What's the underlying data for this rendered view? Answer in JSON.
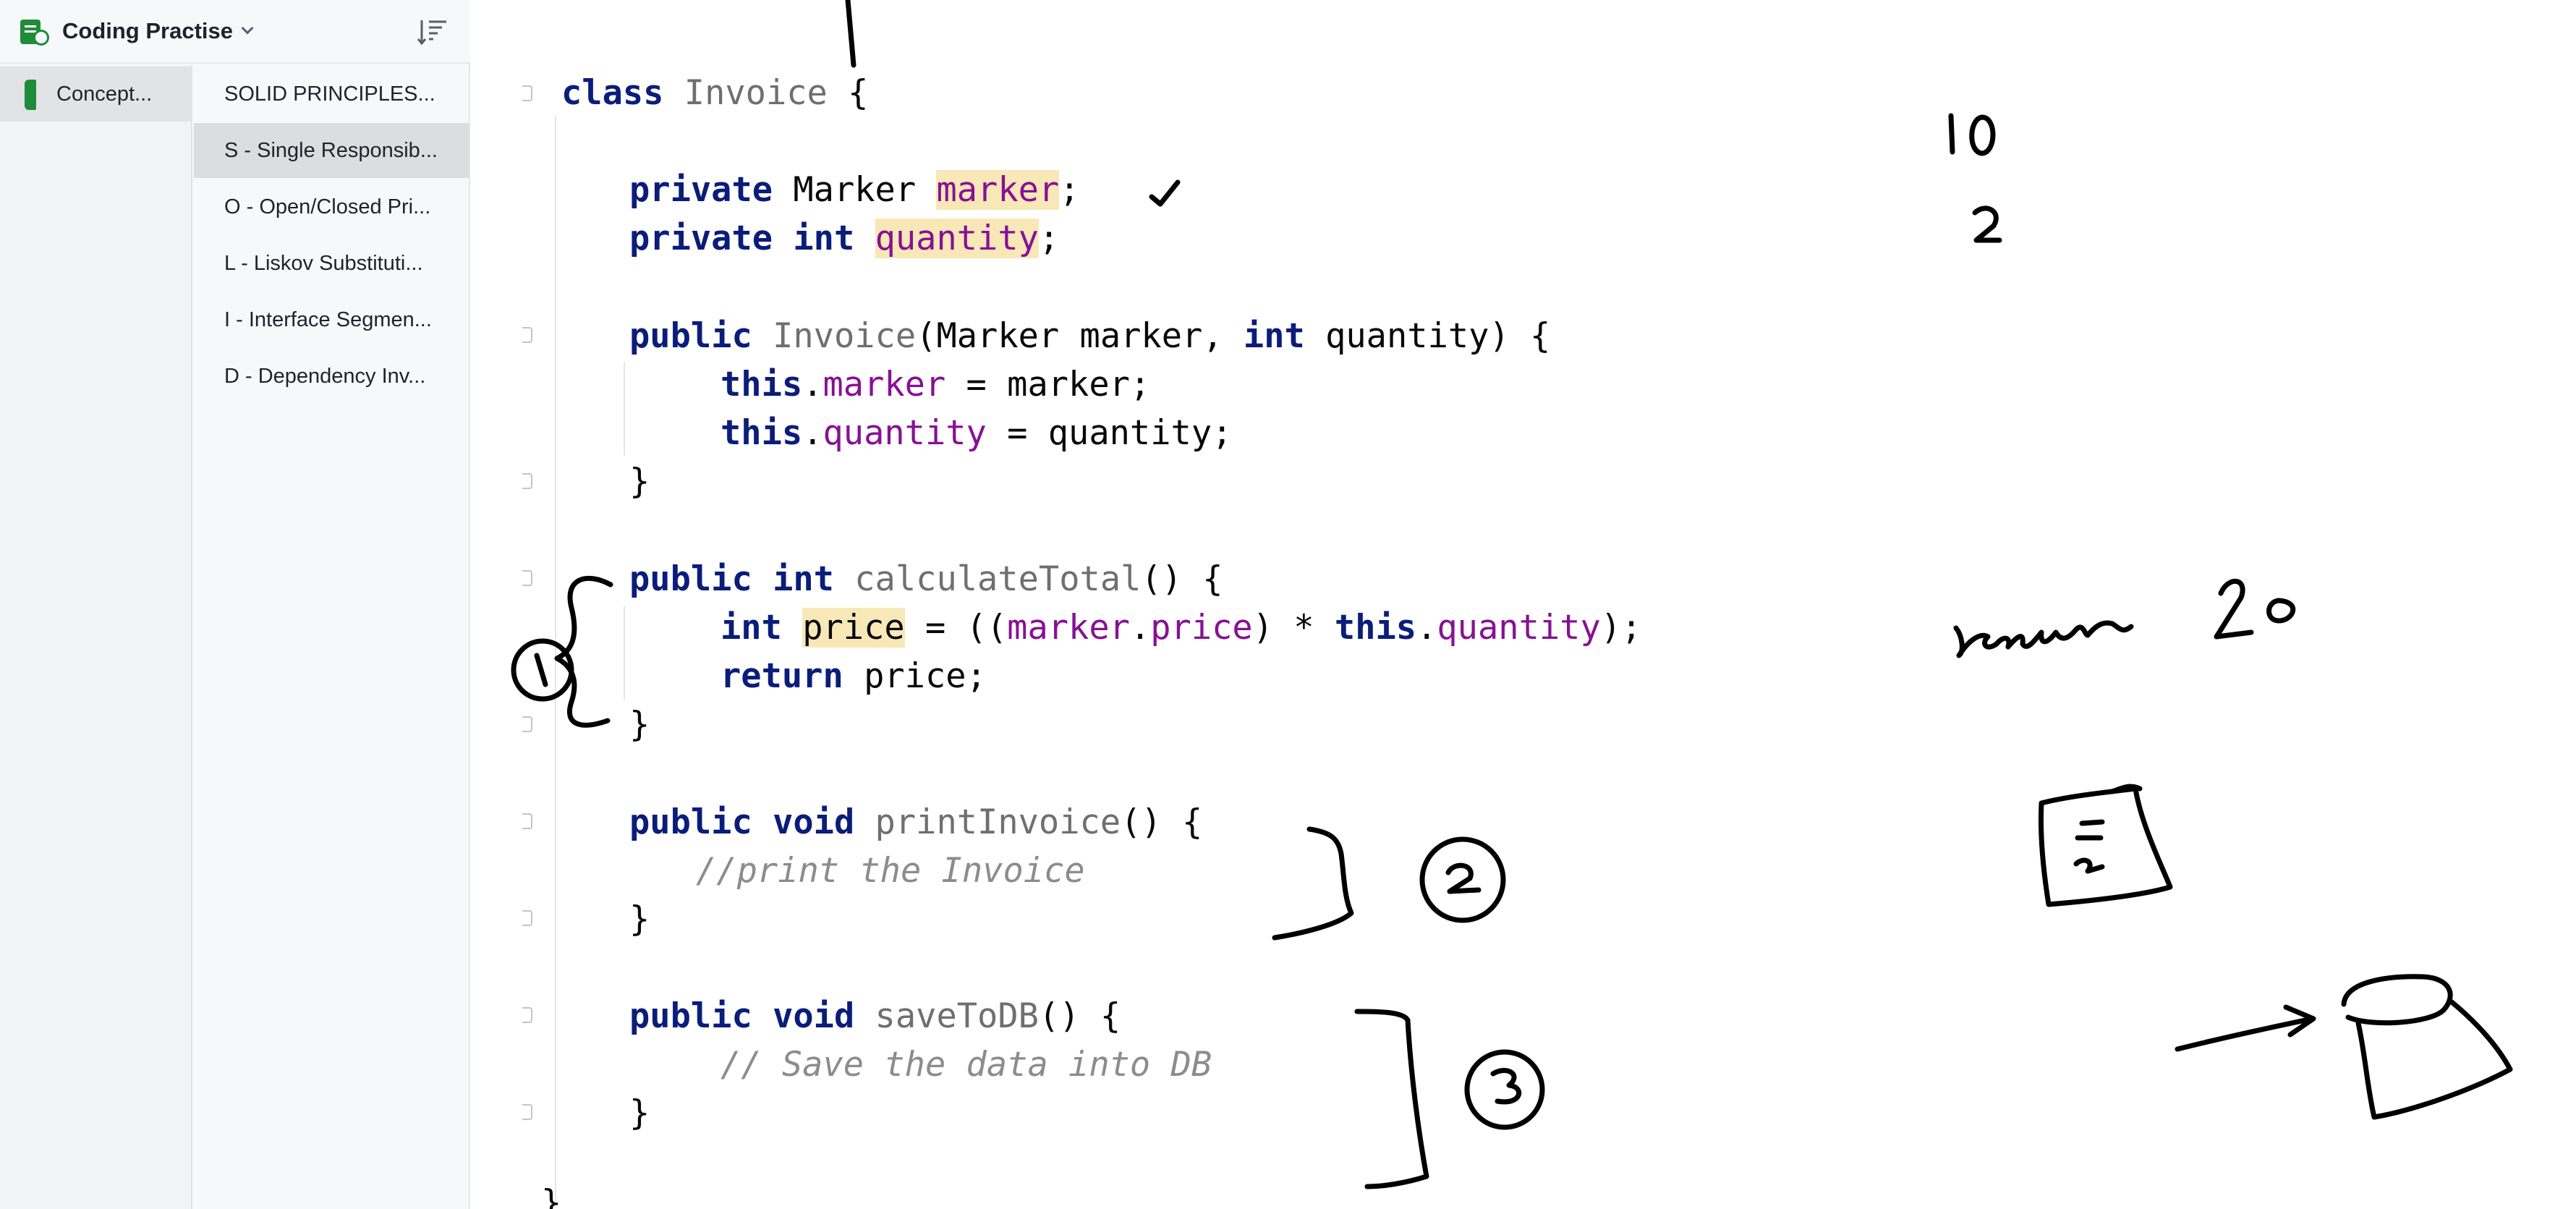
{
  "sidebar": {
    "workspace_title": "Coding Practise",
    "left_items": [
      {
        "label": "Concept..."
      }
    ],
    "right_items": [
      {
        "label": "SOLID PRINCIPLES..."
      },
      {
        "label": "S - Single Responsib..."
      },
      {
        "label": "O - Open/Closed Pri..."
      },
      {
        "label": "L - Liskov Substituti..."
      },
      {
        "label": "I - Interface Segmen..."
      },
      {
        "label": "D - Dependency Inv..."
      }
    ],
    "selected_index": 1,
    "accent_color": "#1e8c3a"
  },
  "editor": {
    "code": {
      "l1_kw": "class",
      "l1_name": "Invoice",
      "l1_rest": " {",
      "l2_kw": "private",
      "l2_type": " Marker ",
      "l2_field": "marker",
      "l2_rest": ";",
      "l3_kw": "private",
      "l3_kw2": " int ",
      "l3_field": "quantity",
      "l3_rest": ";",
      "l4_kw": "public",
      "l4_name": " Invoice",
      "l4_a": "(Marker marker, ",
      "l4_kw2": "int",
      "l4_b": " quantity) {",
      "l5_kw": "this",
      "l5_dot": ".",
      "l5_field": "marker",
      "l5_rest": " = marker;",
      "l6_kw": "this",
      "l6_dot": ".",
      "l6_field": "quantity",
      "l6_rest": " = quantity;",
      "l7": "}",
      "l8_kw": "public int",
      "l8_name": " calculateTotal",
      "l8_rest": "() {",
      "l9_kw": "int",
      "l9_sp": " ",
      "l9_var": "price",
      "l9_a": " = ((",
      "l9_f1": "marker",
      "l9_dot": ".",
      "l9_f2": "price",
      "l9_b": ") * ",
      "l9_kw2": "this",
      "l9_dot2": ".",
      "l9_f3": "quantity",
      "l9_c": ");",
      "l10_kw": "return",
      "l10_rest": " price;",
      "l11": "}",
      "l12_kw": "public void",
      "l12_name": " printInvoice",
      "l12_rest": "() {",
      "l13": "//print the Invoice",
      "l14": "}",
      "l15_kw": "public void",
      "l15_name": " saveToDB",
      "l15_rest": "() {",
      "l16": "// Save the data into DB",
      "l17": "}",
      "l18": "}"
    },
    "colors": {
      "keyword": "#0b1d7a",
      "field": "#871094",
      "comment": "#8c8c8c",
      "highlight": "#f8e8b8"
    }
  },
  "annotations": {
    "num_10": "10",
    "num_2": "2",
    "return_word": "return",
    "num_20": "20",
    "circle_1": "1",
    "circle_2": "2",
    "circle_3": "3",
    "box_mark": "2"
  }
}
